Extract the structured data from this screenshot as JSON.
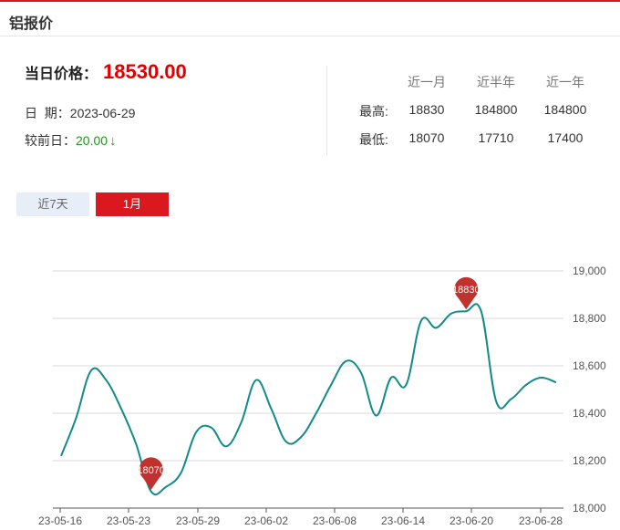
{
  "header": {
    "title": "铝报价"
  },
  "today": {
    "label": "当日价格：",
    "price": "18530.00",
    "date_label": "日  期：",
    "date": "2023-06-29",
    "change_label": "较前日：",
    "change": "20.00",
    "change_arrow": "↓"
  },
  "stats": {
    "headers": [
      "近一月",
      "近半年",
      "近一年"
    ],
    "rows": [
      {
        "label": "最高:",
        "values": [
          "18830",
          "184800",
          "184800"
        ]
      },
      {
        "label": "最低:",
        "values": [
          "18070",
          "17710",
          "17400"
        ]
      }
    ]
  },
  "tabs": [
    {
      "label": "近7天",
      "active": false
    },
    {
      "label": "1月",
      "active": true
    }
  ],
  "colors": {
    "accent": "#d9181f",
    "price": "#e00000",
    "down": "#1a9a1a",
    "line": "#138a8a",
    "pin": "#c0322e"
  },
  "chart_data": {
    "type": "line",
    "x_labels": [
      "23-05-16",
      "23-05-23",
      "23-05-29",
      "23-06-02",
      "23-06-08",
      "23-06-14",
      "23-06-20",
      "23-06-28"
    ],
    "y_ticks": [
      "18,000",
      "18,200",
      "18,400",
      "18,600",
      "18,800",
      "19,000"
    ],
    "ylim": [
      18000,
      19000
    ],
    "grid": true,
    "series": [
      {
        "values": [
          18220,
          18380,
          18580,
          18540,
          18420,
          18270,
          18070,
          18090,
          18150,
          18320,
          18340,
          18260,
          18360,
          18540,
          18420,
          18280,
          18300,
          18400,
          18520,
          18620,
          18570,
          18390,
          18550,
          18520,
          18790,
          18760,
          18820,
          18830,
          18830,
          18450,
          18460,
          18520,
          18550,
          18530
        ]
      }
    ],
    "markers": [
      {
        "label": "18830",
        "index": 27,
        "value": 18830
      },
      {
        "label": "18070",
        "index": 6,
        "value": 18070
      }
    ]
  }
}
